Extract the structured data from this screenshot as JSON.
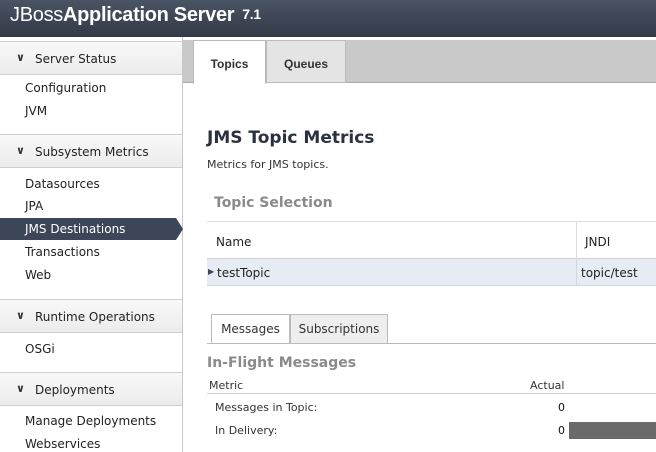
{
  "header": {
    "brand_light": "JBoss",
    "brand_bold": "Application Server",
    "version": "7.1"
  },
  "sidebar": {
    "sections": [
      {
        "label": "Server Status",
        "items": [
          "Configuration",
          "JVM"
        ]
      },
      {
        "label": "Subsystem Metrics",
        "items": [
          "Datasources",
          "JPA",
          "JMS Destinations",
          "Transactions",
          "Web"
        ]
      },
      {
        "label": "Runtime Operations",
        "items": [
          "OSGi"
        ]
      },
      {
        "label": "Deployments",
        "items": [
          "Manage Deployments",
          "Webservices"
        ]
      }
    ],
    "active_item": "JMS Destinations"
  },
  "main": {
    "tabs": [
      {
        "label": "Topics",
        "active": true
      },
      {
        "label": "Queues",
        "active": false
      }
    ],
    "title": "JMS Topic Metrics",
    "subtitle": "Metrics for JMS topics.",
    "selection_heading": "Topic Selection",
    "table": {
      "columns": [
        "Name",
        "JNDI"
      ],
      "rows": [
        {
          "name": "testTopic",
          "jndi": "topic/test"
        }
      ]
    },
    "subtabs": [
      {
        "label": "Messages",
        "active": true
      },
      {
        "label": "Subscriptions",
        "active": false
      }
    ],
    "inflight_heading": "In-Flight Messages",
    "metrics": {
      "columns": [
        "Metric",
        "Actual"
      ],
      "rows": [
        {
          "label": "Messages in Topic:",
          "value": "0",
          "bar_fraction": 0
        },
        {
          "label": "In Delivery:",
          "value": "0",
          "bar_fraction": 1
        }
      ]
    }
  },
  "colors": {
    "header": "#3c4452",
    "active_nav": "#3c4658",
    "row_highlight": "#e6ebf4",
    "heading_gray": "#8a8a8a"
  }
}
